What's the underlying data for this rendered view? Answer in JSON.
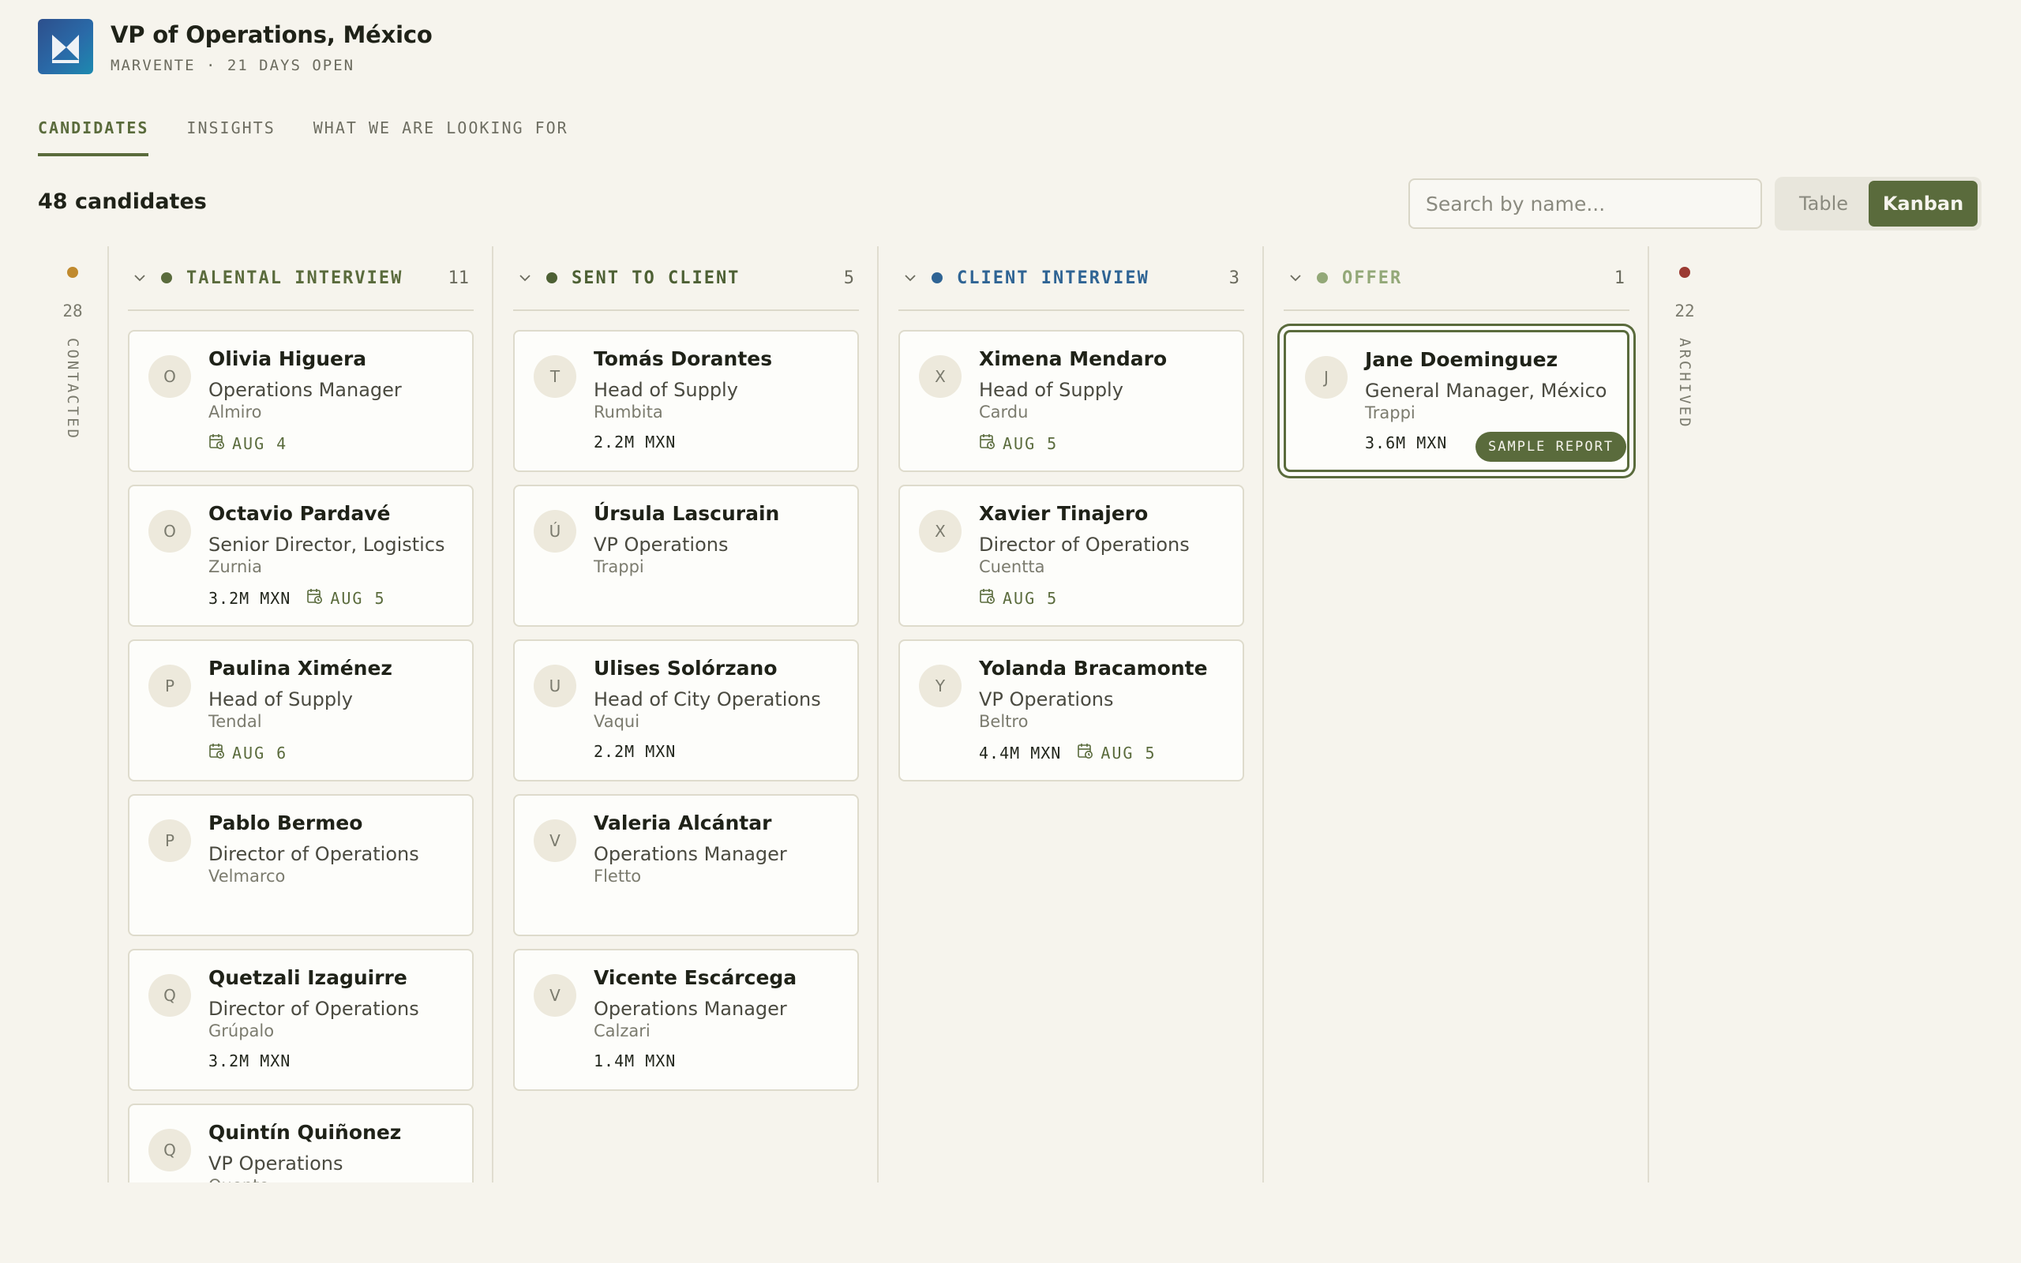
{
  "header": {
    "title": "VP of Operations, México",
    "subtitle": "MARVENTE · 21 DAYS OPEN"
  },
  "tabs": [
    {
      "label": "CANDIDATES",
      "active": true
    },
    {
      "label": "INSIGHTS",
      "active": false
    },
    {
      "label": "WHAT WE ARE LOOKING FOR",
      "active": false
    }
  ],
  "toolbar": {
    "count_label": "48 candidates",
    "search_placeholder": "Search by name...",
    "view_table": "Table",
    "view_kanban": "Kanban",
    "active_view": "Kanban"
  },
  "sidebars": {
    "contacted": {
      "count": "28",
      "label": "CONTACTED",
      "color": "#c08a2e"
    },
    "archived": {
      "count": "22",
      "label": "ARCHIVED",
      "color": "#9b3a32"
    }
  },
  "columns": [
    {
      "name": "TALENTAL INTERVIEW",
      "count": "11",
      "color": "#5a6b3c",
      "cards": [
        {
          "initial": "O",
          "name": "Olivia Higuera",
          "role": "Operations Manager",
          "company": "Almiro",
          "salary": "",
          "date": "AUG 4"
        },
        {
          "initial": "O",
          "name": "Octavio Pardavé",
          "role": "Senior Director, Logistics",
          "company": "Zurnia",
          "salary": "3.2M MXN",
          "date": "AUG 5"
        },
        {
          "initial": "P",
          "name": "Paulina Ximénez",
          "role": "Head of Supply",
          "company": "Tendal",
          "salary": "",
          "date": "AUG 6"
        },
        {
          "initial": "P",
          "name": "Pablo Bermeo",
          "role": "Director of Operations",
          "company": "Velmarco",
          "salary": "",
          "date": ""
        },
        {
          "initial": "Q",
          "name": "Quetzali Izaguirre",
          "role": "Director of Operations",
          "company": "Grúpalo",
          "salary": "3.2M MXN",
          "date": ""
        },
        {
          "initial": "Q",
          "name": "Quintín Quiñonez",
          "role": "VP Operations",
          "company": "Quento",
          "salary": "",
          "date": ""
        }
      ]
    },
    {
      "name": "SENT TO CLIENT",
      "count": "5",
      "color": "#4d6034",
      "cards": [
        {
          "initial": "T",
          "name": "Tomás Dorantes",
          "role": "Head of Supply",
          "company": "Rumbita",
          "salary": "2.2M MXN",
          "date": ""
        },
        {
          "initial": "Ú",
          "name": "Úrsula Lascurain",
          "role": "VP Operations",
          "company": "Trappi",
          "salary": "",
          "date": ""
        },
        {
          "initial": "U",
          "name": "Ulises Solórzano",
          "role": "Head of City Operations",
          "company": "Vaqui",
          "salary": "2.2M MXN",
          "date": ""
        },
        {
          "initial": "V",
          "name": "Valeria Alcántar",
          "role": "Operations Manager",
          "company": "Fletto",
          "salary": "",
          "date": ""
        },
        {
          "initial": "V",
          "name": "Vicente Escárcega",
          "role": "Operations Manager",
          "company": "Calzari",
          "salary": "1.4M MXN",
          "date": ""
        }
      ]
    },
    {
      "name": "CLIENT INTERVIEW",
      "count": "3",
      "color": "#2f6494",
      "cards": [
        {
          "initial": "X",
          "name": "Ximena Mendaro",
          "role": "Head of Supply",
          "company": "Cardu",
          "salary": "",
          "date": "AUG 5"
        },
        {
          "initial": "X",
          "name": "Xavier Tinajero",
          "role": "Director of Operations",
          "company": "Cuentta",
          "salary": "",
          "date": "AUG 5"
        },
        {
          "initial": "Y",
          "name": "Yolanda Bracamonte",
          "role": "VP Operations",
          "company": "Beltro",
          "salary": "4.4M MXN",
          "date": "AUG 5"
        }
      ]
    },
    {
      "name": "OFFER",
      "count": "1",
      "color": "#93a878",
      "cards": [
        {
          "initial": "J",
          "name": "Jane Doeminguez",
          "role": "General Manager, México",
          "company": "Trappi",
          "salary": "3.6M MXN",
          "date": "",
          "badge": "SAMPLE REPORT",
          "selected": true
        }
      ]
    }
  ]
}
